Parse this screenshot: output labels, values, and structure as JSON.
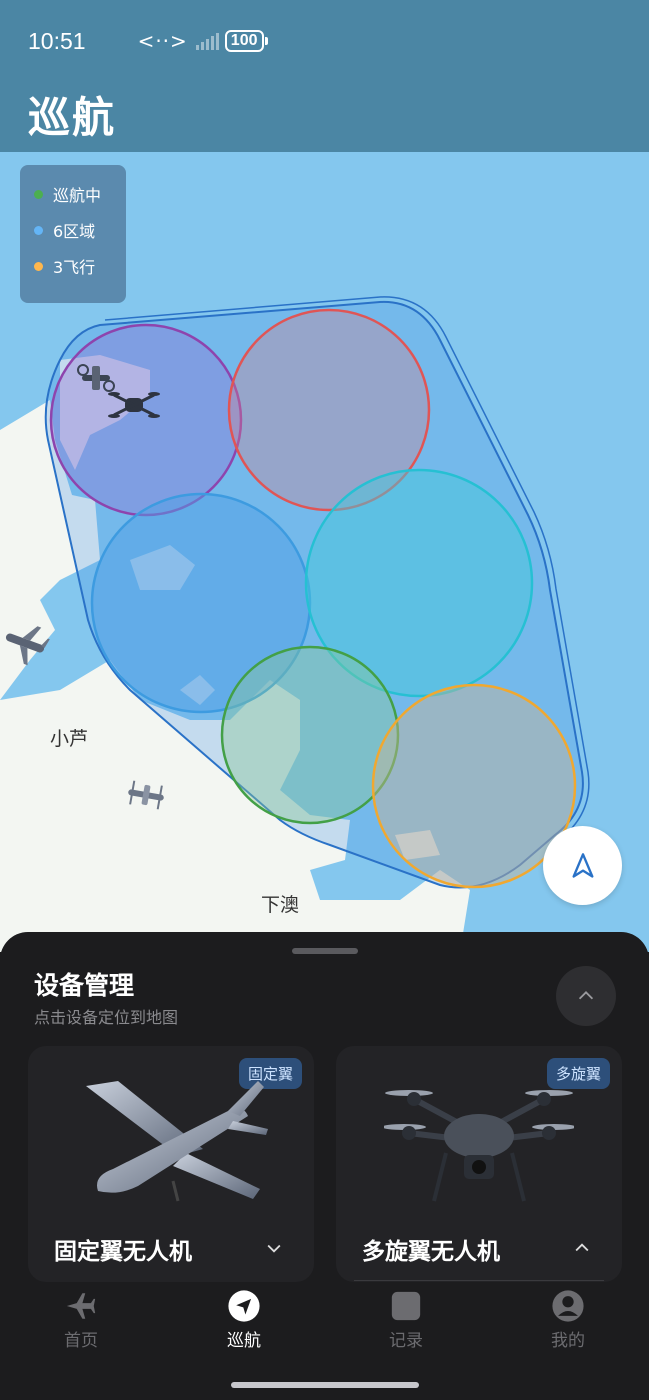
{
  "status_bar": {
    "time": "10:51",
    "network": "<··>",
    "battery": "100"
  },
  "header": {
    "title": "巡航"
  },
  "legend": [
    {
      "label": "巡航中",
      "color": "#4caf50"
    },
    {
      "label": "6区域",
      "color": "#64b5f6"
    },
    {
      "label": "3飞行",
      "color": "#ffb74d"
    }
  ],
  "map": {
    "places": [
      "小芦",
      "下澳"
    ],
    "zone_colors": [
      "#8e44ad",
      "#e05555",
      "#3d9be0",
      "#26c0d3",
      "#43a047",
      "#f0a830"
    ]
  },
  "sheet": {
    "title": "设备管理",
    "subtitle": "点击设备定位到地图",
    "cards": [
      {
        "tag": "固定翼",
        "name": "固定翼无人机",
        "chevron": "down"
      },
      {
        "tag": "多旋翼",
        "name": "多旋翼无人机",
        "chevron": "up"
      }
    ]
  },
  "tabs": [
    {
      "label": "首页",
      "icon": "plane-icon",
      "active": false
    },
    {
      "label": "巡航",
      "icon": "navigation-icon",
      "active": true
    },
    {
      "label": "记录",
      "icon": "record-icon",
      "active": false
    },
    {
      "label": "我的",
      "icon": "profile-icon",
      "active": false
    }
  ]
}
